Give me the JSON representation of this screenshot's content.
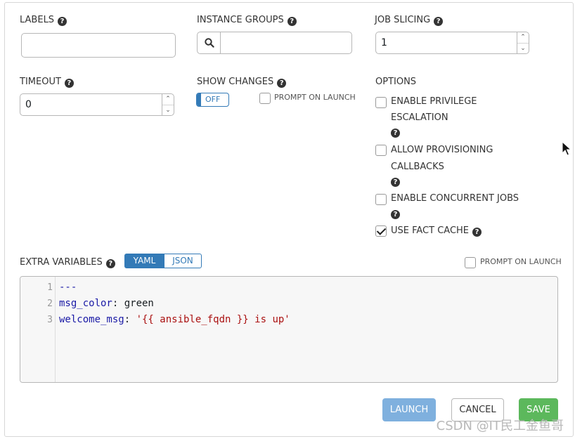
{
  "fields": {
    "labels": {
      "label": "LABELS",
      "value": ""
    },
    "instance_groups": {
      "label": "INSTANCE GROUPS",
      "value": ""
    },
    "job_slicing": {
      "label": "JOB SLICING",
      "value": "1"
    },
    "timeout": {
      "label": "TIMEOUT",
      "value": "0"
    },
    "show_changes": {
      "label": "SHOW CHANGES",
      "toggle": "OFF",
      "prompt_on_launch": "PROMPT ON LAUNCH"
    }
  },
  "options": {
    "label": "OPTIONS",
    "items": [
      {
        "line1": "ENABLE PRIVILEGE",
        "line2": "ESCALATION",
        "checked": false
      },
      {
        "line1": "ALLOW PROVISIONING",
        "line2": "CALLBACKS",
        "checked": false
      },
      {
        "line1": "ENABLE CONCURRENT JOBS",
        "checked": false
      },
      {
        "line1": "USE FACT CACHE",
        "checked": true
      }
    ]
  },
  "extra_variables": {
    "label": "EXTRA VARIABLES",
    "mode_yaml": "YAML",
    "mode_json": "JSON",
    "active_mode": "YAML",
    "prompt_on_launch": "PROMPT ON LAUNCH",
    "lines": [
      {
        "n": "1",
        "key": "---",
        "sep": "",
        "val": ""
      },
      {
        "n": "2",
        "key": "msg_color",
        "sep": ": ",
        "val": "green"
      },
      {
        "n": "3",
        "key": "welcome_msg",
        "sep": ": ",
        "val": "'{{ ansible_fqdn }} is up'"
      }
    ]
  },
  "actions": {
    "launch": "LAUNCH",
    "cancel": "CANCEL",
    "save": "SAVE"
  },
  "watermark": "CSDN @IT民工金鱼哥",
  "colors": {
    "primary": "#337ab7",
    "launch": "#7fb0de",
    "save": "#5cb85c"
  },
  "icons": {
    "help": "question-circle-icon",
    "search": "search-icon",
    "spin_up": "chevron-up-icon",
    "spin_down": "chevron-down-icon"
  }
}
